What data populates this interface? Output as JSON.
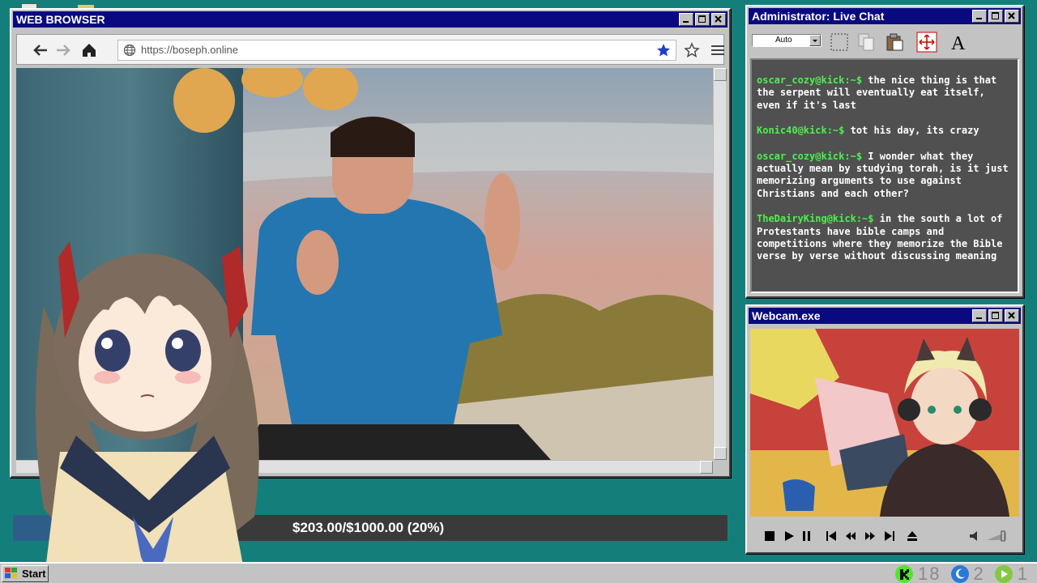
{
  "browser": {
    "title": "WEB BROWSER",
    "url": "https://boseph.online"
  },
  "chat": {
    "title": "Administrator: Live Chat",
    "zoom_select": "Auto",
    "messages": [
      {
        "user": "oscar_cozy@kick:~$",
        "text": " the nice thing is that the serpent will eventually eat itself, even if it's last"
      },
      {
        "user": "Konic40@kick:~$",
        "text": " tot his day, its crazy"
      },
      {
        "user": "oscar_cozy@kick:~$",
        "text": " I wonder what they actually mean by studying torah, is it just memorizing arguments to use against Christians and each other?"
      },
      {
        "user": "TheDairyKing@kick:~$",
        "text": " in the south a lot of Protestants have bible camps and competitions where they memorize the Bible verse by verse without discussing meaning"
      }
    ]
  },
  "webcam": {
    "title": "Webcam.exe"
  },
  "goal": {
    "text": "$203.00/$1000.00 (20%)",
    "current": 203.0,
    "target": 1000.0,
    "fraction": 0.2
  },
  "taskbar": {
    "start_label": "Start",
    "tray_counts": [
      "18",
      "2",
      "1"
    ]
  },
  "colors": {
    "desktop": "#147f7a",
    "titlebar": "#0a0a80",
    "chat_username": "#4df04d",
    "progress_fill": "#2f5d8a"
  }
}
